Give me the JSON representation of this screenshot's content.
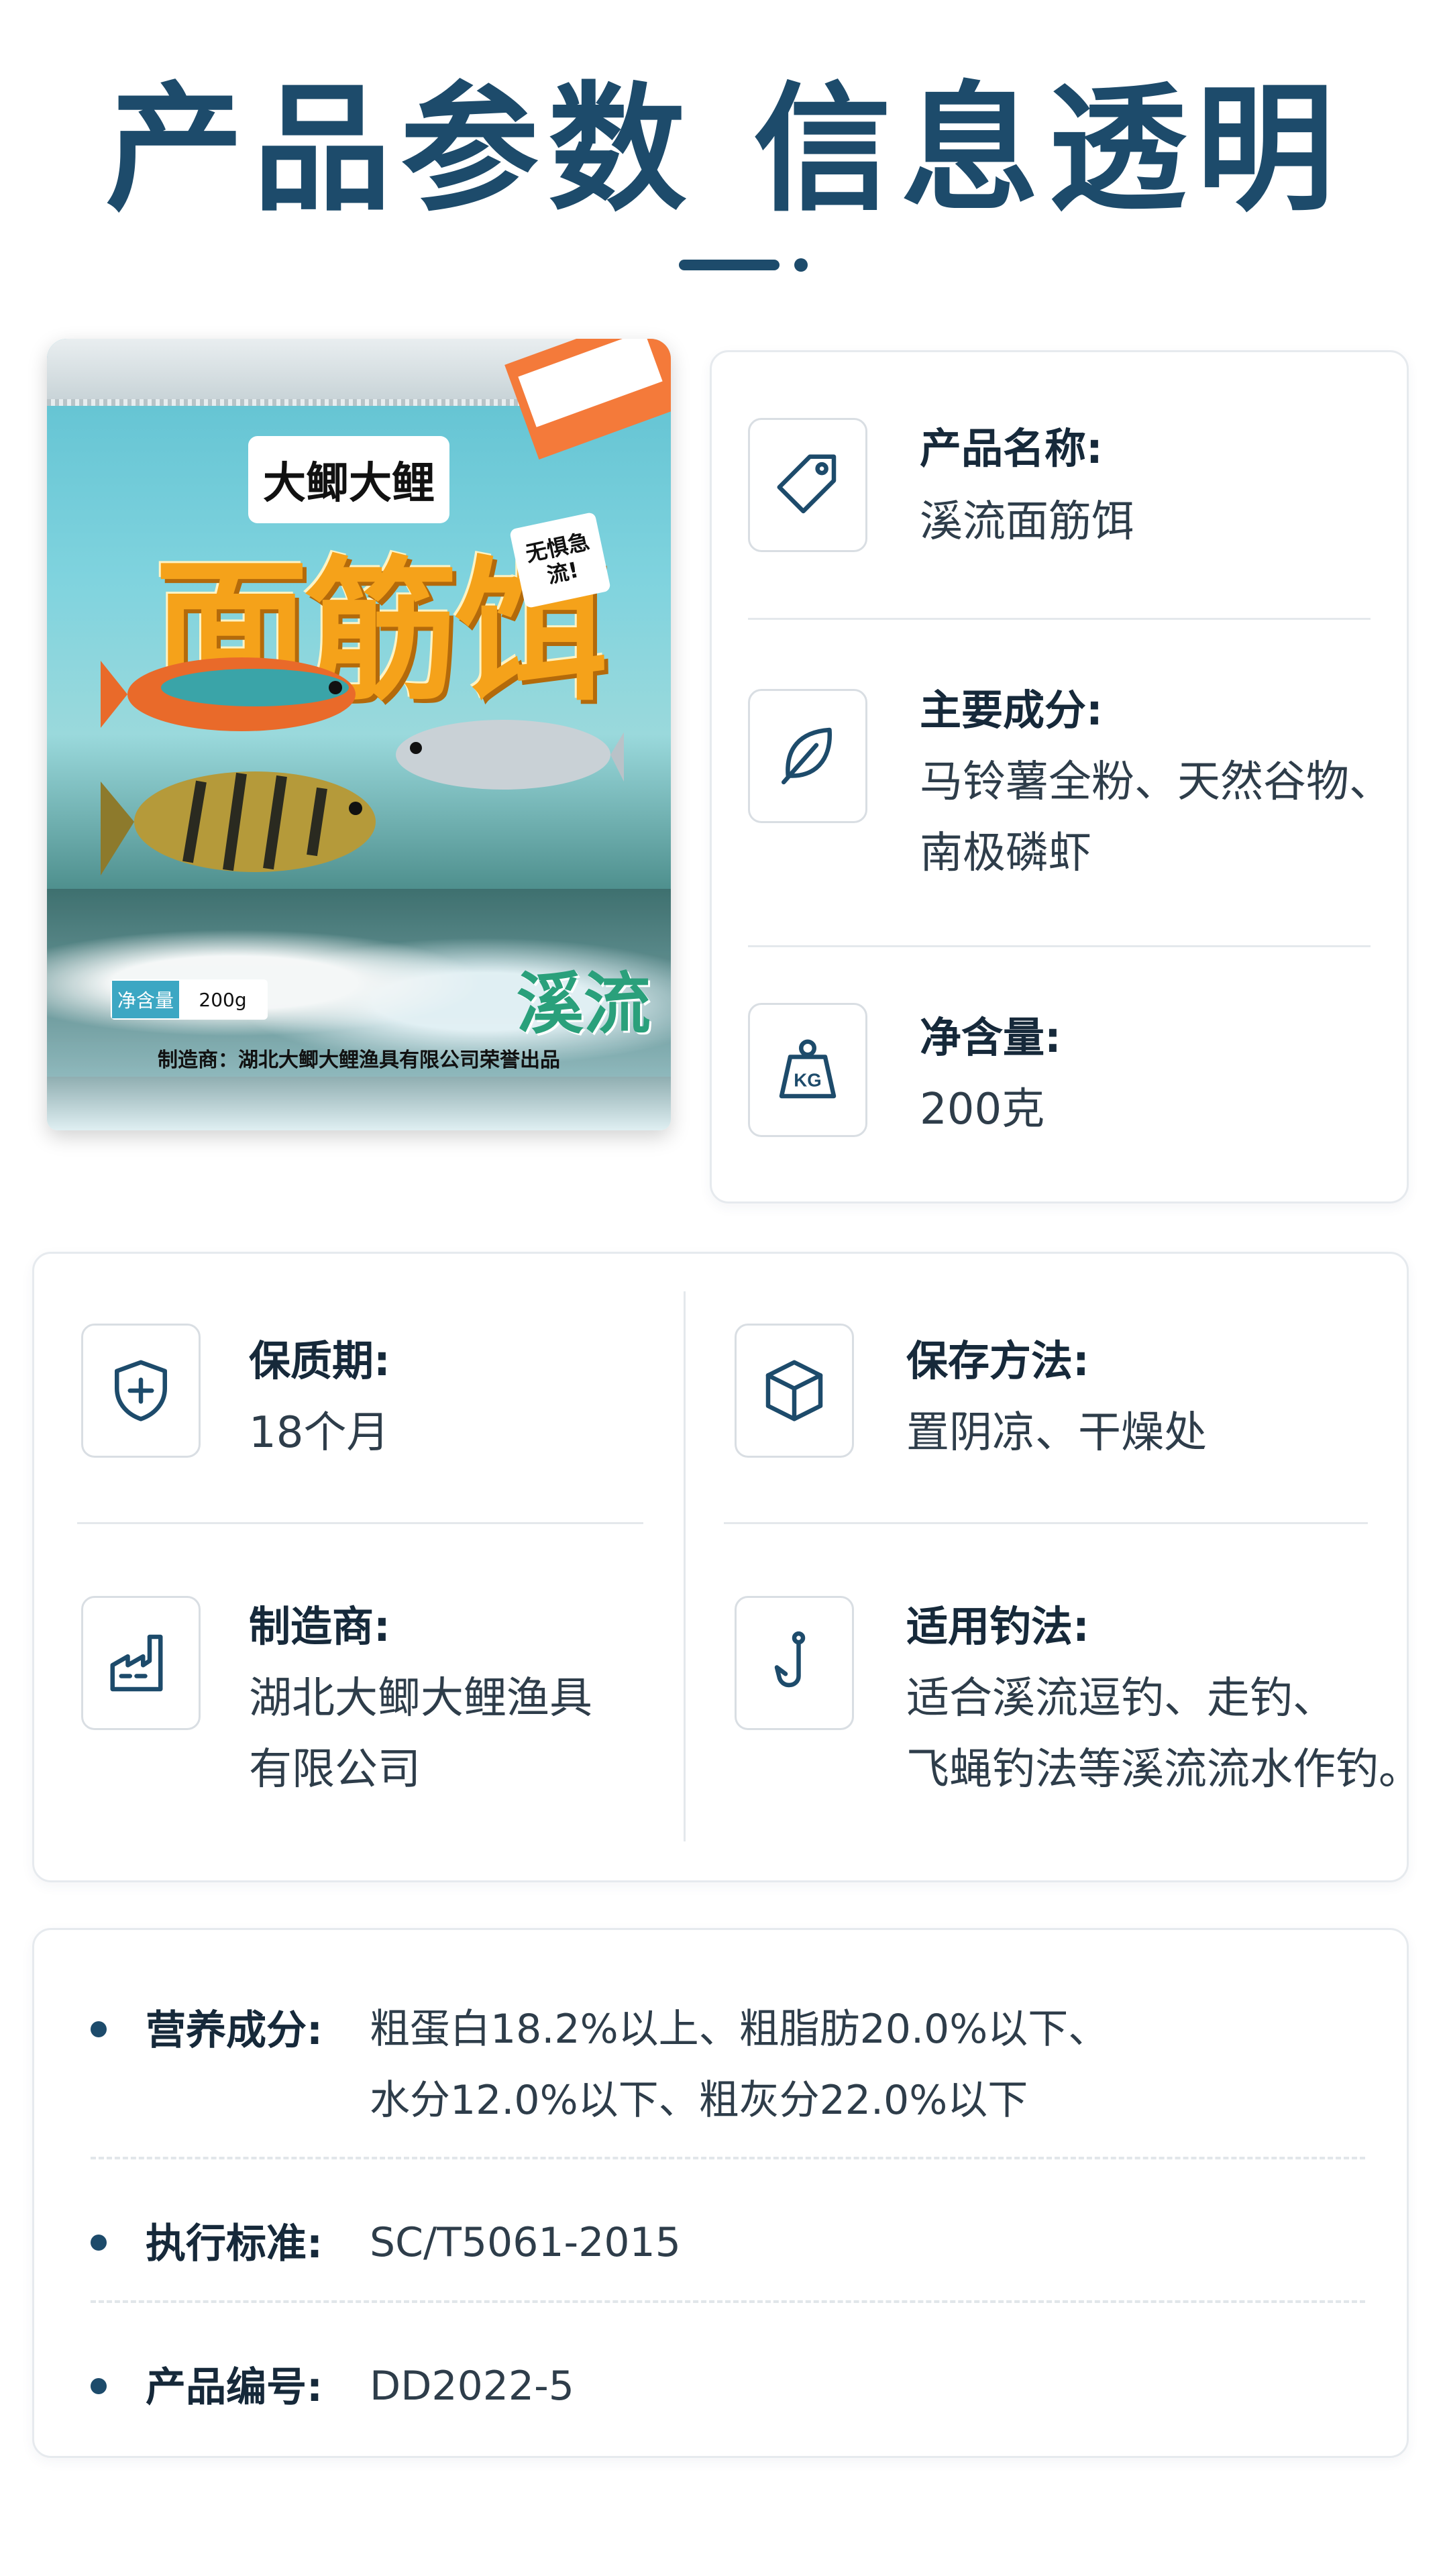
{
  "page_title": "产品参数 信息透明",
  "product_image": {
    "brand": "大鲫大鲤",
    "name": "面筋饵",
    "sticker": "无惧急流!",
    "series": "溪流",
    "net_weight_label": "净含量",
    "net_weight_value": "200g",
    "maker_line": "制造商：湖北大鲫大鲤渔具有限公司荣誉出品"
  },
  "top_card": {
    "items": [
      {
        "icon": "tag-icon",
        "label": "产品名称:",
        "value": "溪流面筋饵"
      },
      {
        "icon": "leaf-icon",
        "label": "主要成分:",
        "value_lines": [
          "马铃薯全粉、天然谷物、",
          "南极磷虾"
        ]
      },
      {
        "icon": "weight-kg-icon",
        "label": "净含量:",
        "value": "200克"
      }
    ]
  },
  "grid_card": {
    "items": [
      {
        "icon": "shield-plus-icon",
        "label": "保质期:",
        "value_lines": [
          "18个月"
        ]
      },
      {
        "icon": "box-icon",
        "label": "保存方法:",
        "value_lines": [
          "置阴凉、干燥处"
        ]
      },
      {
        "icon": "factory-icon",
        "label": "制造商:",
        "value_lines": [
          "湖北大鲫大鲤渔具",
          "有限公司"
        ]
      },
      {
        "icon": "fishhook-icon",
        "label": "适用钓法:",
        "value_lines": [
          "适合溪流逗钓、走钓、",
          "飞蝇钓法等溪流流水作钓。"
        ]
      }
    ]
  },
  "bottom_card": {
    "rows": [
      {
        "label": "营养成分:",
        "value_lines": [
          "粗蛋白18.2%以上、粗脂肪20.0%以下、",
          "水分12.0%以下、粗灰分22.0%以下"
        ]
      },
      {
        "label": "执行标准:",
        "value_lines": [
          "SC/T5061-2015"
        ]
      },
      {
        "label": "产品编号:",
        "value_lines": [
          "DD2022-5"
        ]
      }
    ]
  },
  "colors": {
    "accent": "#1d4b6b",
    "border": "#e6eaee"
  }
}
